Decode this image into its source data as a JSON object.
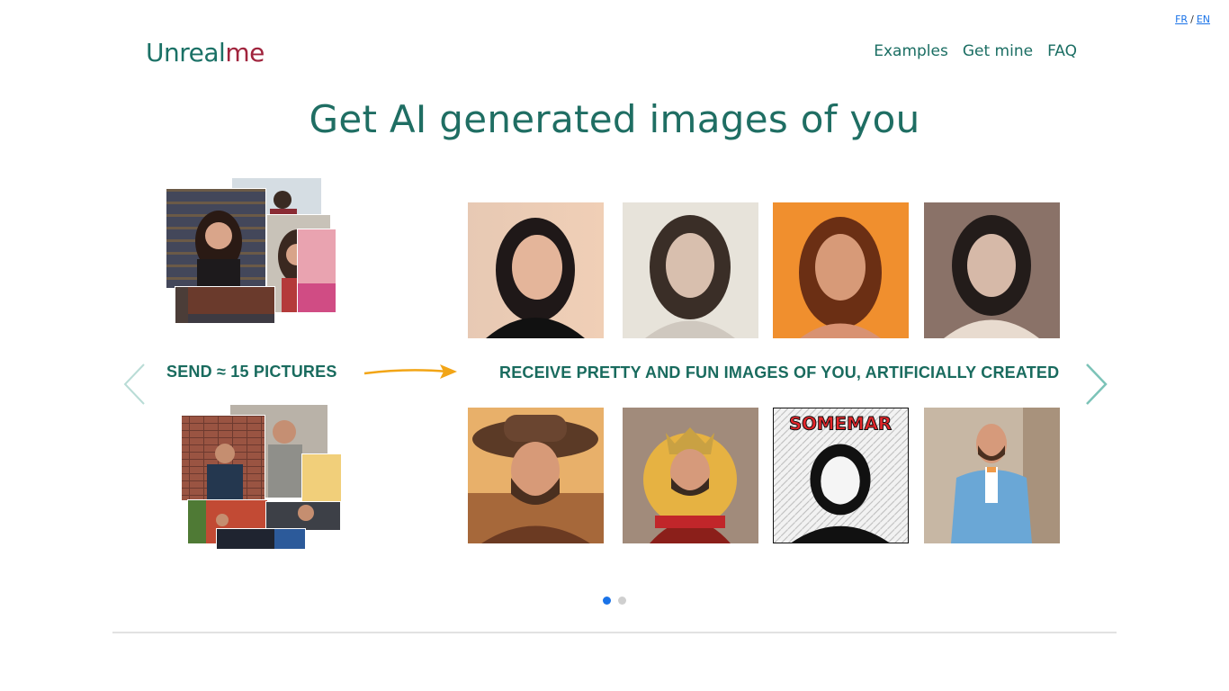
{
  "lang": {
    "fr": "FR",
    "sep": "/",
    "en": "EN"
  },
  "logo": {
    "part1": "Unreal",
    "part2": "me"
  },
  "nav": {
    "items": [
      {
        "label": "Examples"
      },
      {
        "label": "Get mine"
      },
      {
        "label": "FAQ"
      }
    ]
  },
  "hero": {
    "title": "Get AI generated images of you"
  },
  "carousel": {
    "send_label": "SEND ≈ 15 PICTURES",
    "receive_label": "RECEIVE PRETTY AND FUN IMAGES OF YOU, ARTIFICIALLY CREATED",
    "comic_text": "SOMEMAR",
    "slides_total": 2,
    "active_slide": 1
  },
  "colors": {
    "brand_green": "#1b7166",
    "brand_red": "#a0243d",
    "arrow_orange": "#f2a516",
    "dot_active": "#1a73e8",
    "dot_inactive": "#cfcfcf",
    "chevron": "#7cc3b8"
  },
  "icons": {
    "prev": "chevron-left-icon",
    "next": "chevron-right-icon",
    "flow": "arrow-right-icon"
  }
}
